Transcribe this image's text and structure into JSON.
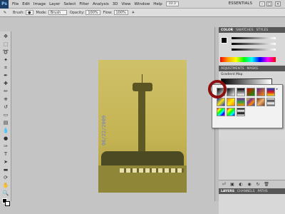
{
  "app": {
    "logo": "Ps",
    "zoom": "33.3",
    "workspace": "ESSENTIALS",
    "menu": [
      "File",
      "Edit",
      "Image",
      "Layer",
      "Select",
      "Filter",
      "Analysis",
      "3D",
      "View",
      "Window",
      "Help"
    ]
  },
  "options": {
    "brush_label": "Brush:",
    "mode_label": "Mode:",
    "mode_value": "Brush",
    "opacity_label": "Opacity:",
    "opacity_value": "100%",
    "flow_label": "Flow:",
    "flow_value": "100%"
  },
  "panels": {
    "color_tabs": [
      "COLOR",
      "SWATCHES",
      "STYLES"
    ],
    "adjust_tabs": [
      "ADJUSTMENTS",
      "MASKS"
    ],
    "adjust_title": "Gradient Map",
    "layers_tabs": [
      "LAYERS",
      "CHANNELS",
      "PATHS"
    ]
  },
  "canvas": {
    "date_stamp": "06/22/2009"
  },
  "gradient_presets": [
    {
      "name": "foreground-to-background",
      "colors": [
        "#000000",
        "#ffffff"
      ]
    },
    {
      "name": "foreground-to-transparent",
      "colors": [
        "#000000",
        "rgba(0,0,0,0)"
      ]
    },
    {
      "name": "black-white",
      "colors": [
        "#000000",
        "#ffffff"
      ]
    },
    {
      "name": "red-green",
      "colors": [
        "#e00000",
        "#00a000"
      ]
    },
    {
      "name": "violet-orange",
      "colors": [
        "#5a1c8c",
        "#ff8a00"
      ]
    },
    {
      "name": "blue-red-yellow",
      "colors": [
        "#1c34c8",
        "#d81818",
        "#f4e010"
      ]
    },
    {
      "name": "blue-yellow-blue",
      "colors": [
        "#1c34c8",
        "#f4e010",
        "#1c34c8"
      ]
    },
    {
      "name": "orange-yellow-orange",
      "colors": [
        "#ff7a00",
        "#ffee00",
        "#ff7a00"
      ]
    },
    {
      "name": "violet-green-orange",
      "colors": [
        "#7a2c9c",
        "#2ca43c",
        "#ff8a00"
      ]
    },
    {
      "name": "yellow-violet-orange-blue",
      "colors": [
        "#f4e010",
        "#7a2c9c",
        "#ff8a00",
        "#1c34c8"
      ]
    },
    {
      "name": "copper",
      "colors": [
        "#7a3c10",
        "#f0b070",
        "#7a3c10"
      ]
    },
    {
      "name": "chrome",
      "colors": [
        "#ffffff",
        "#404040",
        "#ffffff",
        "#606060"
      ]
    },
    {
      "name": "spectrum",
      "colors": [
        "red",
        "yellow",
        "lime",
        "cyan",
        "blue",
        "magenta"
      ]
    },
    {
      "name": "transparent-rainbow",
      "colors": [
        "red",
        "yellow",
        "lime",
        "cyan",
        "blue"
      ]
    },
    {
      "name": "transparent-stripes",
      "colors": [
        "#000000",
        "#ffffff",
        "#000000",
        "#ffffff"
      ]
    }
  ],
  "colors": {
    "highlight_ring": "#8b0f0f",
    "panel_header": "#575757"
  }
}
